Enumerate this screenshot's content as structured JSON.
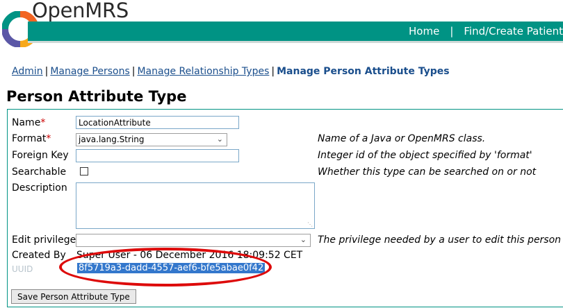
{
  "brand": {
    "name": "OpenMRS"
  },
  "topnav": {
    "home": "Home",
    "separator": "|",
    "find_patient": "Find/Create Patient"
  },
  "breadcrumb": {
    "admin": "Admin",
    "manage_persons": "Manage Persons",
    "manage_relationship_types": "Manage Relationship Types",
    "current": "Manage Person Attribute Types",
    "separator": "|"
  },
  "page": {
    "title": "Person Attribute Type"
  },
  "form": {
    "name_label": "Name",
    "required_marker": "*",
    "name_value": "LocationAttribute",
    "format_label": "Format",
    "format_value": "java.lang.String",
    "format_help": "Name of a Java or OpenMRS class.",
    "foreign_key_label": "Foreign Key",
    "foreign_key_value": "",
    "foreign_key_help": "Integer id of the object specified by 'format'",
    "searchable_label": "Searchable",
    "searchable_checked": false,
    "searchable_help": "Whether this type can be searched on or not",
    "description_label": "Description",
    "description_value": "",
    "edit_privilege_label": "Edit privilege",
    "edit_privilege_value": "",
    "edit_privilege_help": "The privilege needed by a user to edit this person",
    "created_by_label": "Created By",
    "created_by_value": "Super User - 06 December 2016 18:09:52 CET",
    "uuid_label": "UUID",
    "uuid_value": "8f5719a3-dadd-4557-aef6-bfe5abae0f42",
    "save_button": "Save Person Attribute Type"
  },
  "colors": {
    "brand_teal": "#009384",
    "link_blue": "#1a4e8c",
    "annotation_red": "#dd0a0a",
    "selection_blue": "#3377cc"
  },
  "icons": [
    "openmrs-logo",
    "chevron-down-icon",
    "resize-grip-icon"
  ]
}
